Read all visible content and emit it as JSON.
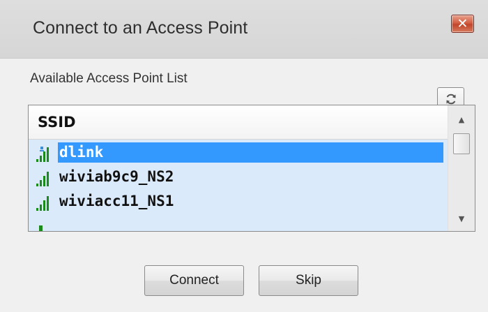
{
  "window": {
    "title": "Connect to an Access Point",
    "close_icon": "close-icon"
  },
  "list": {
    "heading": "Available Access Point List",
    "refresh_icon": "refresh-icon",
    "column_header": "SSID",
    "rows": [
      {
        "ssid": "dlink",
        "selected": true,
        "icon": "signal-strength-icon",
        "signal_bars": 4
      },
      {
        "ssid": "wiviab9c9_NS2",
        "selected": false,
        "icon": "signal-strength-icon",
        "signal_bars": 4
      },
      {
        "ssid": "wiviacc11_NS1",
        "selected": false,
        "icon": "signal-strength-icon",
        "signal_bars": 4
      }
    ]
  },
  "buttons": {
    "connect": "Connect",
    "skip": "Skip"
  },
  "colors": {
    "selection": "#3399ff",
    "list_background": "#dbeafb",
    "signal_green": "#1a8a1a",
    "close_red": "#c1452a"
  }
}
